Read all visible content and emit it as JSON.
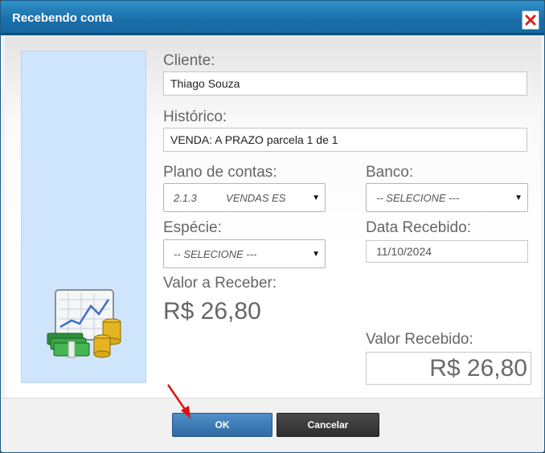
{
  "dialog": {
    "title": "Recebendo conta",
    "close_icon": "close-x-icon",
    "accent_color": "#1a6ea8"
  },
  "form": {
    "cliente_label": "Cliente:",
    "cliente_value": "Thiago Souza",
    "historico_label": "Histórico:",
    "historico_value": "VENDA: A PRAZO parcela 1  de 1",
    "plano_label": "Plano de contas:",
    "plano_value": "2.1.3          VENDAS ES",
    "banco_label": "Banco:",
    "banco_value": "-- SELECIONE ---",
    "especie_label": "Espécie:",
    "especie_value": "-- SELECIONE ---",
    "data_label": "Data Recebido:",
    "data_value": "11/10/2024",
    "valor_receber_label": "Valor a Receber:",
    "valor_receber_value": "R$ 26,80",
    "valor_recebido_label": "Valor Recebido:",
    "valor_recebido_value": "R$ 26,80"
  },
  "illustration_icon": "money-chart-icon",
  "buttons": {
    "ok_label": "OK",
    "cancel_label": "Cancelar"
  },
  "annotation": {
    "arrow_icon": "red-arrow-icon",
    "color": "#e01010"
  }
}
